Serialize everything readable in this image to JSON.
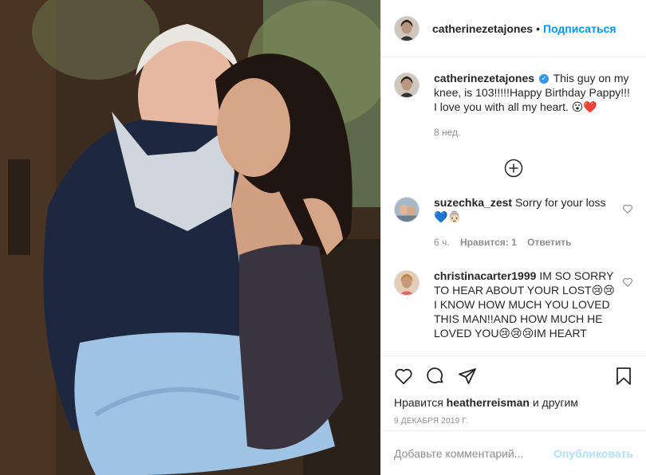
{
  "header": {
    "username": "catherinezetajones",
    "separator": "•",
    "follow_label": "Подписаться"
  },
  "caption": {
    "username": "catherinezetajones",
    "text": "This guy on my knee, is 103!!!!!Happy Birthday Pappy!!! I love you with all my heart. 😮❤️",
    "time": "8 нед."
  },
  "comments": [
    {
      "username": "suzechka_zest",
      "text": "Sorry for your loss 💙👵🏻",
      "time": "6 ч.",
      "likes": "Нравится: 1",
      "reply_label": "Ответить"
    },
    {
      "username": "christinacarter1999",
      "text": "IM SO SORRY TO HEAR ABOUT YOUR LOST😢😢 I KNOW HOW MUCH YOU LOVED THIS MAN!!AND HOW MUCH HE LOVED YOU😢😢😢IM HEART"
    }
  ],
  "actions": {
    "likes_prefix": "Нравится",
    "likes_user": "heatherreisman",
    "likes_suffix": "и другим",
    "date": "9 декабря 2019 г."
  },
  "add_comment": {
    "placeholder": "Добавьте комментарий...",
    "post_label": "Опубликовать"
  },
  "icons": [
    "plus-circle-icon",
    "heart-icon",
    "comment-icon",
    "share-icon",
    "bookmark-icon"
  ],
  "colors": {
    "accent": "#0095f6",
    "verified": "#3897f0",
    "muted": "#8e8e8e"
  }
}
